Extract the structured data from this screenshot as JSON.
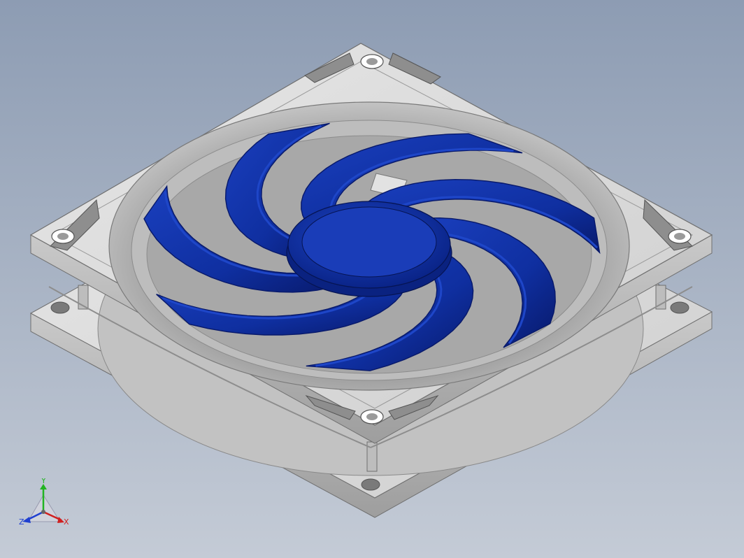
{
  "viewport": {
    "background_top": "#8d9cb3",
    "background_bottom": "#c4cbd6"
  },
  "model": {
    "frame_color": "#d6d6d6",
    "frame_shadow_color": "#a8a8a8",
    "impeller_color": "#0f2fa0",
    "impeller_highlight": "#1e46c8",
    "impeller_dark": "#08196a",
    "blade_count": 7
  },
  "triad": {
    "y_label": "Y",
    "x_label": "X",
    "z_label": "Z",
    "y_color": "#22b422",
    "x_color": "#d02020",
    "z_color": "#2040d0"
  }
}
